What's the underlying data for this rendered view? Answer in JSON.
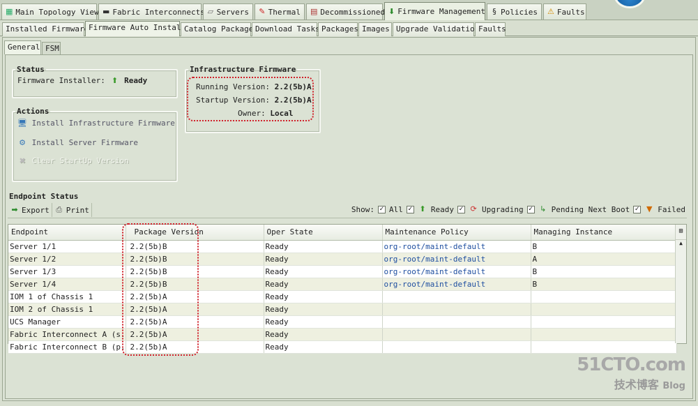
{
  "top_tabs": [
    {
      "label": "Main Topology View",
      "icon": "topology-icon"
    },
    {
      "label": "Fabric Interconnects",
      "icon": "fabric-interconnect-icon"
    },
    {
      "label": "Servers",
      "icon": "server-icon"
    },
    {
      "label": "Thermal",
      "icon": "thermal-icon"
    },
    {
      "label": "Decommissioned",
      "icon": "decommissioned-icon"
    },
    {
      "label": "Firmware Management",
      "icon": "firmware-icon",
      "active": true
    },
    {
      "label": "Policies",
      "icon": "policies-icon"
    },
    {
      "label": "Faults",
      "icon": "faults-icon"
    }
  ],
  "sub_tabs": [
    "Installed Firmware",
    "Firmware Auto Install",
    "Catalog Package",
    "Download Tasks",
    "Packages",
    "Images",
    "Upgrade Validation",
    "Faults"
  ],
  "active_sub_tab": "Firmware Auto Install",
  "inner_tabs": [
    "General",
    "FSM"
  ],
  "status": {
    "title": "Status",
    "installer_label": "Firmware Installer:",
    "installer_value": "Ready"
  },
  "actions": {
    "title": "Actions",
    "items": [
      "Install Infrastructure Firmware",
      "Install Server Firmware",
      "Clear StartUp Version"
    ]
  },
  "infra": {
    "title": "Infrastructure Firmware",
    "running_label": "Running Version:",
    "running_value": "2.2(5b)A",
    "startup_label": "Startup Version:",
    "startup_value": "2.2(5b)A",
    "owner_label": "Owner:",
    "owner_value": "Local"
  },
  "endpoint": {
    "title": "Endpoint Status",
    "export": "Export",
    "print": "Print",
    "show_label": "Show:",
    "filters": [
      "All",
      "Ready",
      "Upgrading",
      "Pending Next Boot",
      "Failed"
    ],
    "columns": [
      "Endpoint",
      "Package Version",
      "Oper State",
      "Maintenance Policy",
      "Managing Instance"
    ],
    "rows": [
      [
        "Server 1/1",
        "2.2(5b)B",
        "Ready",
        "org-root/maint-default",
        "B"
      ],
      [
        "Server 1/2",
        "2.2(5b)B",
        "Ready",
        "org-root/maint-default",
        "A"
      ],
      [
        "Server 1/3",
        "2.2(5b)B",
        "Ready",
        "org-root/maint-default",
        "B"
      ],
      [
        "Server 1/4",
        "2.2(5b)B",
        "Ready",
        "org-root/maint-default",
        "B"
      ],
      [
        "IOM 1 of Chassis 1",
        "2.2(5b)A",
        "Ready",
        "",
        ""
      ],
      [
        "IOM 2 of Chassis 1",
        "2.2(5b)A",
        "Ready",
        "",
        ""
      ],
      [
        "UCS Manager",
        "2.2(5b)A",
        "Ready",
        "",
        ""
      ],
      [
        "Fabric Interconnect A (s...",
        "2.2(5b)A",
        "Ready",
        "",
        ""
      ],
      [
        "Fabric Interconnect B (p...",
        "2.2(5b)A",
        "Ready",
        "",
        ""
      ]
    ]
  },
  "watermark": {
    "line1": "51CTO.com",
    "line2": "技术博客",
    "line3": "Blog"
  }
}
